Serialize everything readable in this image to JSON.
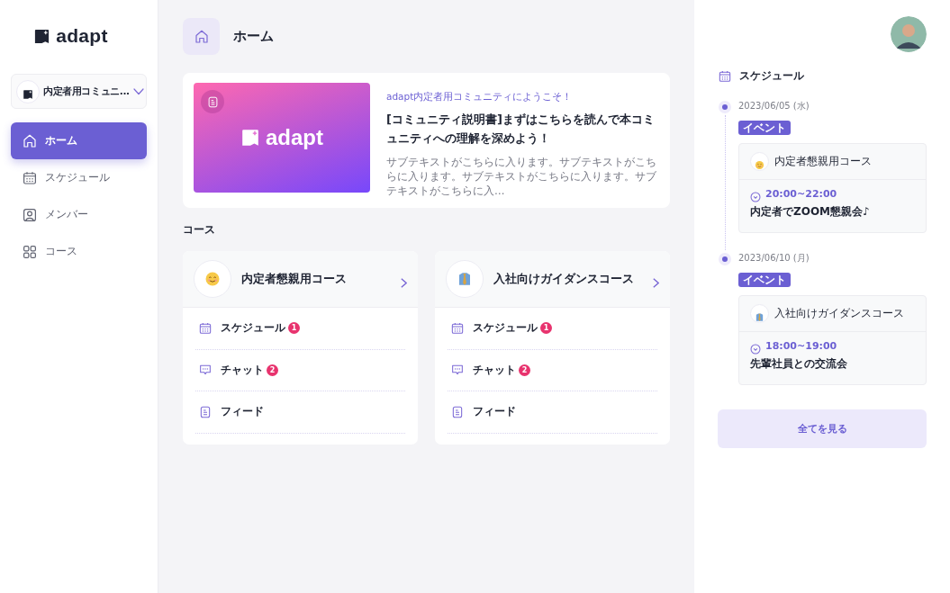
{
  "sidebar": {
    "logo": "adapt",
    "community": "内定者用コミュニ...",
    "items": [
      {
        "label": "ホーム",
        "kind": "home",
        "selected": true
      },
      {
        "label": "スケジュール",
        "kind": "calendar",
        "selected": false
      },
      {
        "label": "メンバー",
        "kind": "member",
        "selected": false
      },
      {
        "label": "コース",
        "kind": "grid",
        "selected": false
      }
    ]
  },
  "header": {
    "title": "ホーム"
  },
  "featured": {
    "logo": "adapt",
    "kicker": "adapt内定者用コミュニティにようこそ！",
    "title": "[コミュニティ説明書]まずはこちらを読んで本コミュニティへの理解を深めよう！",
    "body": "サブテキストがこちらに入ります。サブテキストがこちらに入ります。サブテキストがこちらに入ります。サブテキストがこちらに入…"
  },
  "courses_title": "コース",
  "courses": [
    {
      "name": "内定者懇親用コース",
      "kind": "smile",
      "items": [
        {
          "label": "スケジュール",
          "kind": "calendar",
          "badge": "1"
        },
        {
          "label": "チャット",
          "kind": "chat",
          "badge": "2"
        },
        {
          "label": "フィード",
          "kind": "feed"
        }
      ]
    },
    {
      "name": "入社向けガイダンスコース",
      "kind": "tie",
      "items": [
        {
          "label": "スケジュール",
          "kind": "calendar",
          "badge": "1"
        },
        {
          "label": "チャット",
          "kind": "chat",
          "badge": "2"
        },
        {
          "label": "フィード",
          "kind": "feed"
        }
      ]
    }
  ],
  "schedule": {
    "title": "スケジュール",
    "events": [
      {
        "date": "2023/06/05 (水)",
        "tag": "イベント",
        "course": "内定者懇親用コース",
        "kind": "smile",
        "time": "20:00~22:00",
        "title": "内定者でZOOM懇親会♪"
      },
      {
        "date": "2023/06/10 (月)",
        "tag": "イベント",
        "course": "入社向けガイダンスコース",
        "kind": "tie",
        "time": "18:00~19:00",
        "title": "先輩社員との交流会"
      }
    ],
    "button": "全てを見る"
  }
}
